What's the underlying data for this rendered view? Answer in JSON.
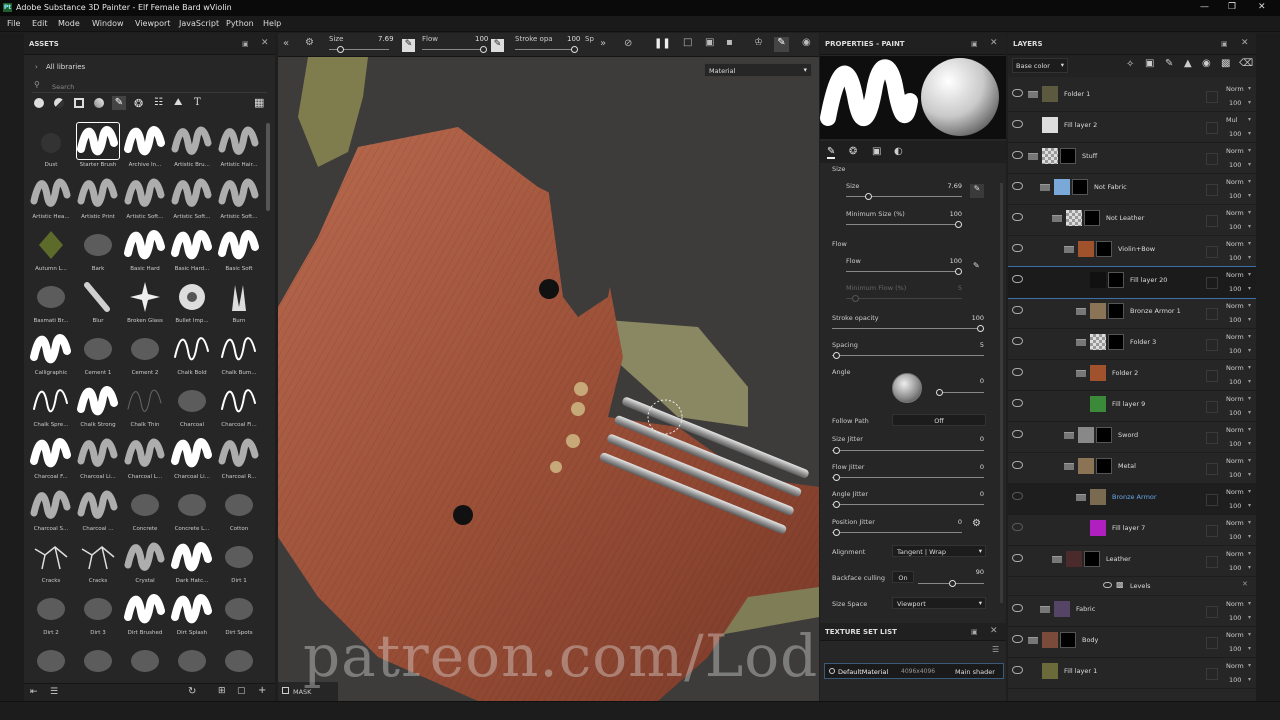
{
  "window": {
    "title": "Adobe Substance 3D Painter - Elf Female Bard wViolin",
    "logo": "Pt"
  },
  "menu": [
    "File",
    "Edit",
    "Mode",
    "Window",
    "Viewport",
    "JavaScript",
    "Python",
    "Help"
  ],
  "assets": {
    "title": "ASSETS",
    "library": "All libraries",
    "search_placeholder": "Search",
    "brushes": [
      "Dust",
      "Starter Brush",
      "Archive In...",
      "Artistic Bru...",
      "Artistic Hair...",
      "Artistic Hea...",
      "Artistic Print",
      "Artistic Soft...",
      "Artistic Soft...",
      "Artistic Soft...",
      "Autumn L...",
      "Bark",
      "Basic Hard",
      "Basic Hard...",
      "Basic Soft",
      "Basmati Br...",
      "Blur",
      "Broken Glass",
      "Bullet Imp...",
      "Burn",
      "Calligraphic",
      "Cement 1",
      "Cement 2",
      "Chalk Bold",
      "Chalk Bum...",
      "Chalk Spre...",
      "Chalk Strong",
      "Chalk Thin",
      "Charcoal",
      "Charcoal Fi...",
      "Charcoal F...",
      "Charcoal Li...",
      "Charcoal L...",
      "Charcoal Li...",
      "Charcoal R...",
      "Charcoal S...",
      "Charcoal ...",
      "Concrete",
      "Concrete L...",
      "Cotton",
      "Cracks",
      "Cracks",
      "Crystal",
      "Dark Hatc...",
      "Dirt 1",
      "Dirt 2",
      "Dirt 3",
      "Dirt Brushed",
      "Dirt Splash",
      "Dirt Spots",
      "",
      "",
      "",
      "",
      ""
    ]
  },
  "toolbar": {
    "size_label": "Size",
    "size_value": "7.69",
    "flow_label": "Flow",
    "flow_value": "100",
    "stroke_label": "Stroke opa",
    "stroke_value": "100",
    "sp_label": "Sp",
    "size_pct": 0.2,
    "flow_pct": 1.0,
    "stroke_pct": 1.0
  },
  "viewport": {
    "material_mode": "Material",
    "mask_label": "MASK",
    "watermark": "patreon.com/Lodaim"
  },
  "properties": {
    "title": "PROPERTIES - PAINT",
    "size_header": "Size",
    "size_label": "Size",
    "size_value": "7.69",
    "min_size_label": "Minimum Size (%)",
    "min_size_value": "100",
    "flow_header": "Flow",
    "flow_label": "Flow",
    "flow_value": "100",
    "min_flow_label": "Minimum Flow (%)",
    "min_flow_value": "5",
    "stroke_opacity_label": "Stroke opacity",
    "stroke_opacity_value": "100",
    "spacing_label": "Spacing",
    "spacing_value": "5",
    "angle_label": "Angle",
    "angle_value": "0",
    "follow_path_label": "Follow Path",
    "follow_path_value": "Off",
    "size_jitter_label": "Size Jitter",
    "size_jitter_value": "0",
    "flow_jitter_label": "Flow Jitter",
    "flow_jitter_value": "0",
    "angle_jitter_label": "Angle Jitter",
    "angle_jitter_value": "0",
    "position_jitter_label": "Position Jitter",
    "position_jitter_value": "0",
    "alignment_label": "Alignment",
    "alignment_value": "Tangent | Wrap",
    "backface_label": "Backface culling",
    "backface_value": "On",
    "backface_num": "90",
    "size_space_label": "Size Space",
    "size_space_value": "Viewport"
  },
  "texture_set": {
    "title": "TEXTURE SET LIST",
    "material": "DefaultMaterial",
    "resolution": "4096x4096",
    "shader": "Main shader"
  },
  "layers": {
    "title": "LAYERS",
    "channel": "Base color",
    "items": [
      {
        "name": "Folder 1",
        "blend": "Norm",
        "opacity": "100"
      },
      {
        "name": "Fill layer 2",
        "blend": "Mul",
        "opacity": "100"
      },
      {
        "name": "Stuff",
        "blend": "Norm",
        "opacity": "100"
      },
      {
        "name": "Not Fabric",
        "blend": "Norm",
        "opacity": "100"
      },
      {
        "name": "Not Leather",
        "blend": "Norm",
        "opacity": "100"
      },
      {
        "name": "Violin+Bow",
        "blend": "Norm",
        "opacity": "100"
      },
      {
        "name": "Fill layer 20",
        "blend": "Norm",
        "opacity": "100"
      },
      {
        "name": "Bronze Armor 1",
        "blend": "Norm",
        "opacity": "100"
      },
      {
        "name": "Folder 3",
        "blend": "Norm",
        "opacity": "100"
      },
      {
        "name": "Folder 2",
        "blend": "Norm",
        "opacity": "100"
      },
      {
        "name": "Fill layer 9",
        "blend": "Norm",
        "opacity": "100"
      },
      {
        "name": "Sword",
        "blend": "Norm",
        "opacity": "100"
      },
      {
        "name": "Metal",
        "blend": "Norm",
        "opacity": "100"
      },
      {
        "name": "Bronze Armor",
        "blend": "Norm",
        "opacity": "100"
      },
      {
        "name": "Fill layer 7",
        "blend": "Norm",
        "opacity": "100"
      },
      {
        "name": "Leather",
        "blend": "Norm",
        "opacity": "100"
      },
      {
        "name": "Levels",
        "blend": "",
        "opacity": ""
      },
      {
        "name": "Fabric",
        "blend": "Norm",
        "opacity": "100"
      },
      {
        "name": "Body",
        "blend": "Norm",
        "opacity": "100"
      },
      {
        "name": "Fill layer 1",
        "blend": "Norm",
        "opacity": "100"
      }
    ]
  }
}
